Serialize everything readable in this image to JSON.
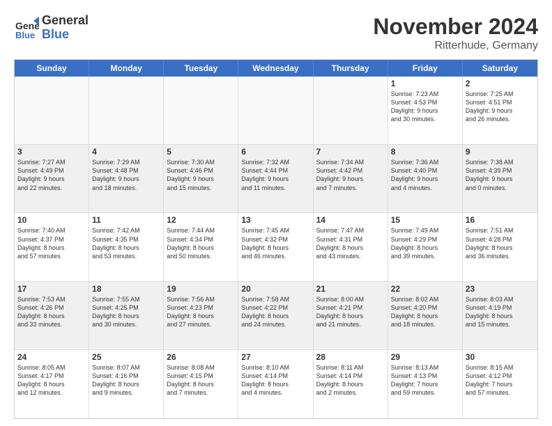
{
  "logo": {
    "line1": "General",
    "line2": "Blue"
  },
  "title": "November 2024",
  "subtitle": "Ritterhude, Germany",
  "header_days": [
    "Sunday",
    "Monday",
    "Tuesday",
    "Wednesday",
    "Thursday",
    "Friday",
    "Saturday"
  ],
  "weeks": [
    [
      {
        "day": "",
        "info": ""
      },
      {
        "day": "",
        "info": ""
      },
      {
        "day": "",
        "info": ""
      },
      {
        "day": "",
        "info": ""
      },
      {
        "day": "",
        "info": ""
      },
      {
        "day": "1",
        "info": "Sunrise: 7:23 AM\nSunset: 4:53 PM\nDaylight: 9 hours\nand 30 minutes."
      },
      {
        "day": "2",
        "info": "Sunrise: 7:25 AM\nSunset: 4:51 PM\nDaylight: 9 hours\nand 26 minutes."
      }
    ],
    [
      {
        "day": "3",
        "info": "Sunrise: 7:27 AM\nSunset: 4:49 PM\nDaylight: 9 hours\nand 22 minutes."
      },
      {
        "day": "4",
        "info": "Sunrise: 7:29 AM\nSunset: 4:48 PM\nDaylight: 9 hours\nand 18 minutes."
      },
      {
        "day": "5",
        "info": "Sunrise: 7:30 AM\nSunset: 4:46 PM\nDaylight: 9 hours\nand 15 minutes."
      },
      {
        "day": "6",
        "info": "Sunrise: 7:32 AM\nSunset: 4:44 PM\nDaylight: 9 hours\nand 11 minutes."
      },
      {
        "day": "7",
        "info": "Sunrise: 7:34 AM\nSunset: 4:42 PM\nDaylight: 9 hours\nand 7 minutes."
      },
      {
        "day": "8",
        "info": "Sunrise: 7:36 AM\nSunset: 4:40 PM\nDaylight: 9 hours\nand 4 minutes."
      },
      {
        "day": "9",
        "info": "Sunrise: 7:38 AM\nSunset: 4:39 PM\nDaylight: 9 hours\nand 0 minutes."
      }
    ],
    [
      {
        "day": "10",
        "info": "Sunrise: 7:40 AM\nSunset: 4:37 PM\nDaylight: 8 hours\nand 57 minutes."
      },
      {
        "day": "11",
        "info": "Sunrise: 7:42 AM\nSunset: 4:35 PM\nDaylight: 8 hours\nand 53 minutes."
      },
      {
        "day": "12",
        "info": "Sunrise: 7:44 AM\nSunset: 4:34 PM\nDaylight: 8 hours\nand 50 minutes."
      },
      {
        "day": "13",
        "info": "Sunrise: 7:45 AM\nSunset: 4:32 PM\nDaylight: 8 hours\nand 46 minutes."
      },
      {
        "day": "14",
        "info": "Sunrise: 7:47 AM\nSunset: 4:31 PM\nDaylight: 8 hours\nand 43 minutes."
      },
      {
        "day": "15",
        "info": "Sunrise: 7:49 AM\nSunset: 4:29 PM\nDaylight: 8 hours\nand 39 minutes."
      },
      {
        "day": "16",
        "info": "Sunrise: 7:51 AM\nSunset: 4:28 PM\nDaylight: 8 hours\nand 36 minutes."
      }
    ],
    [
      {
        "day": "17",
        "info": "Sunrise: 7:53 AM\nSunset: 4:26 PM\nDaylight: 8 hours\nand 33 minutes."
      },
      {
        "day": "18",
        "info": "Sunrise: 7:55 AM\nSunset: 4:25 PM\nDaylight: 8 hours\nand 30 minutes."
      },
      {
        "day": "19",
        "info": "Sunrise: 7:56 AM\nSunset: 4:23 PM\nDaylight: 8 hours\nand 27 minutes."
      },
      {
        "day": "20",
        "info": "Sunrise: 7:58 AM\nSunset: 4:22 PM\nDaylight: 8 hours\nand 24 minutes."
      },
      {
        "day": "21",
        "info": "Sunrise: 8:00 AM\nSunset: 4:21 PM\nDaylight: 8 hours\nand 21 minutes."
      },
      {
        "day": "22",
        "info": "Sunrise: 8:02 AM\nSunset: 4:20 PM\nDaylight: 8 hours\nand 18 minutes."
      },
      {
        "day": "23",
        "info": "Sunrise: 8:03 AM\nSunset: 4:19 PM\nDaylight: 8 hours\nand 15 minutes."
      }
    ],
    [
      {
        "day": "24",
        "info": "Sunrise: 8:05 AM\nSunset: 4:17 PM\nDaylight: 8 hours\nand 12 minutes."
      },
      {
        "day": "25",
        "info": "Sunrise: 8:07 AM\nSunset: 4:16 PM\nDaylight: 8 hours\nand 9 minutes."
      },
      {
        "day": "26",
        "info": "Sunrise: 8:08 AM\nSunset: 4:15 PM\nDaylight: 8 hours\nand 7 minutes."
      },
      {
        "day": "27",
        "info": "Sunrise: 8:10 AM\nSunset: 4:14 PM\nDaylight: 8 hours\nand 4 minutes."
      },
      {
        "day": "28",
        "info": "Sunrise: 8:11 AM\nSunset: 4:14 PM\nDaylight: 8 hours\nand 2 minutes."
      },
      {
        "day": "29",
        "info": "Sunrise: 8:13 AM\nSunset: 4:13 PM\nDaylight: 7 hours\nand 59 minutes."
      },
      {
        "day": "30",
        "info": "Sunrise: 8:15 AM\nSunset: 4:12 PM\nDaylight: 7 hours\nand 57 minutes."
      }
    ]
  ]
}
